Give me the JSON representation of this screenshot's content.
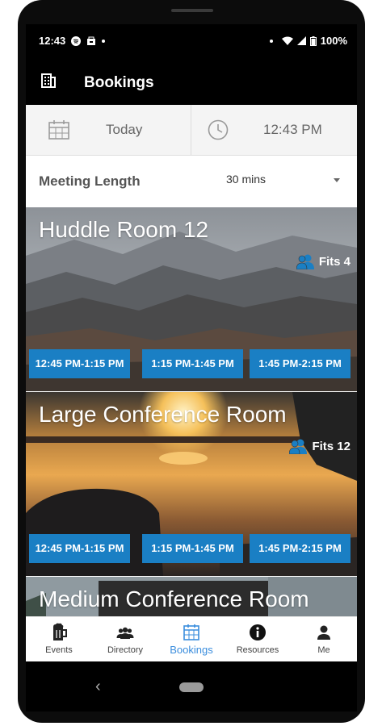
{
  "status_bar": {
    "time": "12:43",
    "battery": "100%"
  },
  "app_bar": {
    "title": "Bookings"
  },
  "pickers": {
    "date": "Today",
    "time": "12:43 PM"
  },
  "meeting_length": {
    "label": "Meeting Length",
    "value": "30 mins"
  },
  "rooms": [
    {
      "name": "Huddle Room 12",
      "fits": "Fits 4",
      "slots": [
        "12:45 PM-1:15 PM",
        "1:15 PM-1:45 PM",
        "1:45 PM-2:15 PM"
      ]
    },
    {
      "name": "Large Conference Room",
      "fits": "Fits 12",
      "slots": [
        "12:45 PM-1:15 PM",
        "1:15 PM-1:45 PM",
        "1:45 PM-2:15 PM"
      ]
    },
    {
      "name": "Medium Conference Room"
    }
  ],
  "bottom_nav": [
    {
      "label": "Events",
      "icon": "beer-mug-icon",
      "active": false
    },
    {
      "label": "Directory",
      "icon": "people-group-icon",
      "active": false
    },
    {
      "label": "Bookings",
      "icon": "calendar-icon",
      "active": true
    },
    {
      "label": "Resources",
      "icon": "info-circle-icon",
      "active": false
    },
    {
      "label": "Me",
      "icon": "person-icon",
      "active": false
    }
  ],
  "colors": {
    "accent": "#1a7fc4",
    "active_nav": "#3a8ddd",
    "app_bar": "#000000"
  }
}
